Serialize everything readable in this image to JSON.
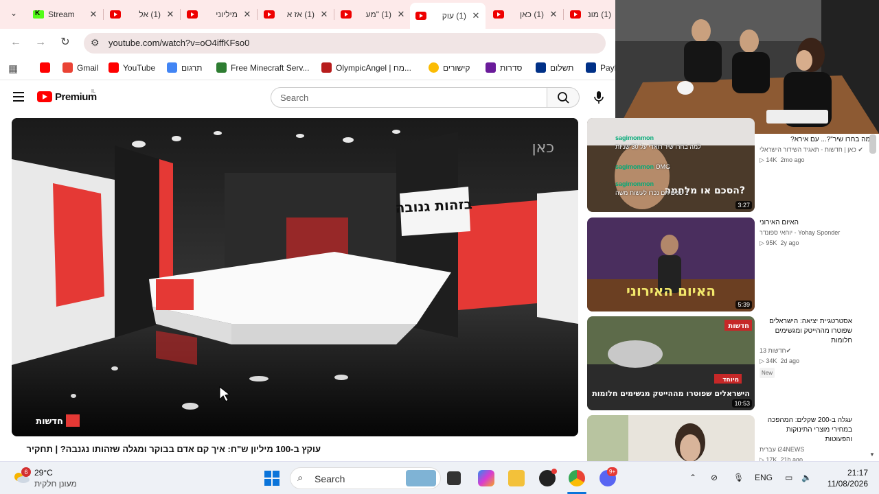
{
  "browser": {
    "tabs": [
      {
        "title": "Stream",
        "icon": "kick-icon"
      },
      {
        "title": "(1) אל",
        "icon": "youtube-icon"
      },
      {
        "title": "מיליוני",
        "icon": "youtube-icon"
      },
      {
        "title": "(1) אז א",
        "icon": "youtube-icon"
      },
      {
        "title": "(1) \"מע",
        "icon": "youtube-icon"
      },
      {
        "title": "(1) עוק",
        "icon": "youtube-icon",
        "active": true
      },
      {
        "title": "(1) כאן",
        "icon": "youtube-icon"
      },
      {
        "title": "(1) מונ",
        "icon": "youtube-icon"
      }
    ],
    "url": "youtube.com/watch?v=oO4iffKFso0",
    "bookmarks": [
      {
        "label": "",
        "color": "#ff0000"
      },
      {
        "label": "Gmail",
        "color": "#ea4335"
      },
      {
        "label": "YouTube",
        "color": "#ff0000"
      },
      {
        "label": "תרגום",
        "color": "#4285f4"
      },
      {
        "label": "Free Minecraft Serv...",
        "color": "#2e7d32"
      },
      {
        "label": "OlympicAngel | מח...",
        "color": "#b71c1c"
      },
      {
        "label": "קישורים",
        "color": "#fbbc04"
      },
      {
        "label": "סדרות",
        "color": "#6a1b9a"
      },
      {
        "label": "תשלום",
        "color": "#003087"
      },
      {
        "label": "PayP",
        "color": "#003087"
      }
    ]
  },
  "youtube": {
    "logo_text": "Premium",
    "logo_region": "IL",
    "search_placeholder": "Search",
    "video_title": "עוקץ ב-100 מיליון ש\"ח: איך קם אדם בבוקר ומגלה שזהותו נגנבה? | תחקיר",
    "overlay_text": {
      "studio_sign": "בזהות גנובה",
      "channel_badge": "חדשות",
      "corner_logo": "כאן"
    }
  },
  "chat_overlay": [
    {
      "user": "sagimonmon",
      "text": "למה בחרו שיר רואדי על 30 שניות"
    },
    {
      "user": "sagimonmon",
      "text": "OMG"
    },
    {
      "user": "sagimonmon",
      "text": "1 שנים הם נכרו לעשות משה"
    }
  ],
  "sidebar": [
    {
      "title": "\"למה בחרו שיר\"?... עם אירא?",
      "channel": "כאן | חדשות - תאגיד השידור הישראלי",
      "verified": true,
      "views": "14K",
      "age": "2mo ago",
      "duration": "3:27",
      "thumb_caption": "הסכם או מלחמה?"
    },
    {
      "title": "האיום האירוני",
      "channel": "Yohay Sponder - יוחאי ספונדר",
      "verified": false,
      "views": "95K",
      "age": "2y ago",
      "duration": "5:39",
      "thumb_caption": "האיום האירוני"
    },
    {
      "title": "אסטרטגיית יציאה: הישראלים שפוטרו מההייטק ומגשימים חלומות",
      "channel": "חדשות 13",
      "verified": true,
      "views": "34K",
      "age": "2d ago",
      "duration": "10:53",
      "badge": "New",
      "thumb_caption": "הישראלים שפוטרו מההייטק מגשימים חלומות",
      "thumb_tag": "מיוחד",
      "thumb_logo": "חדשות"
    },
    {
      "title": "עגלה ב-200 שקלים: המהפכה במחירי מוצרי התינוקות והפעוטות",
      "channel": "i24NEWS עברית",
      "verified": false,
      "views": "17K",
      "age": "21h ago",
      "duration": "",
      "thumb_caption": ""
    }
  ],
  "taskbar": {
    "weather_temp": "29°C",
    "weather_desc": "מעונן חלקית",
    "weather_badge": "6",
    "search_label": "Search",
    "discord_badge": "9+",
    "lang": "ENG",
    "time": "21:17",
    "date": "11/08/2026"
  },
  "colors": {
    "accent": "#ff0000",
    "tabstrip": "#fdeaea",
    "taskbar": "#eef1f6"
  }
}
